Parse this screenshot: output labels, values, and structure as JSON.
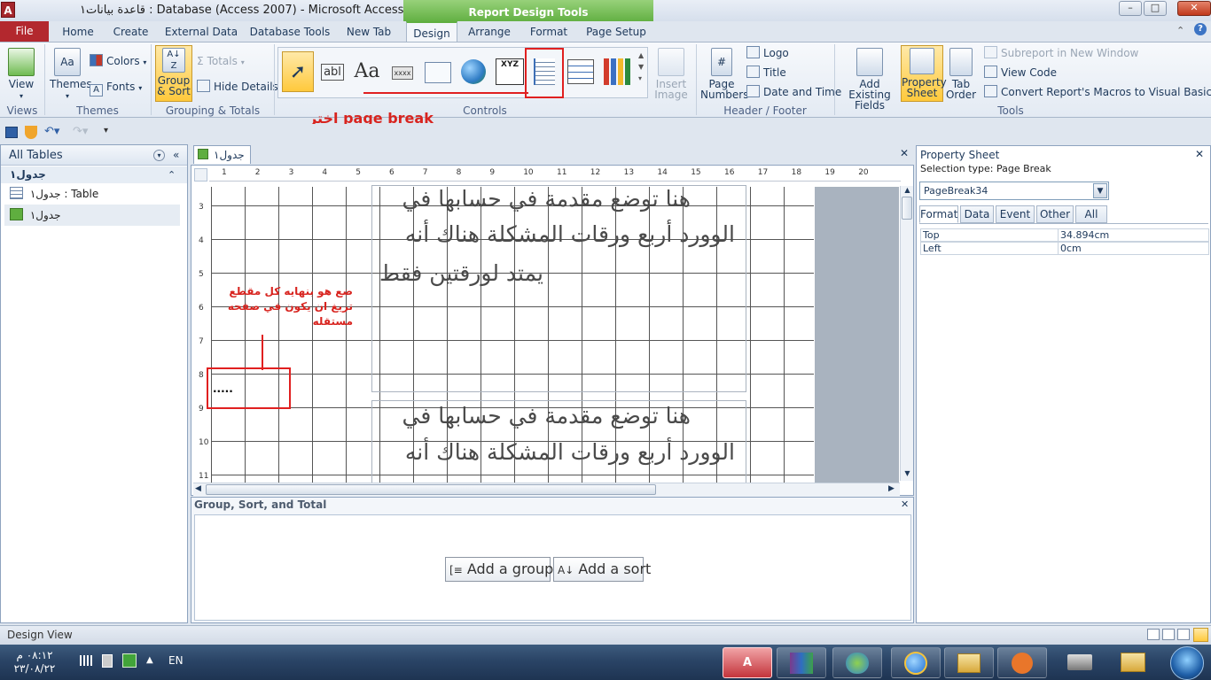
{
  "window": {
    "title": "قاعدة بيانات١ : Database (Access 2007)  -  Microsoft Access",
    "context_tab_group": "Report Design Tools",
    "app_icon_label": "A",
    "minimize": "–",
    "maximize": "□",
    "close": "✕"
  },
  "ribbon_tabs": [
    "File",
    "Home",
    "Create",
    "External Data",
    "Database Tools",
    "New Tab",
    "Design",
    "Arrange",
    "Format",
    "Page Setup"
  ],
  "ribbon": {
    "views": {
      "view_label": "View",
      "group": "Views"
    },
    "themes": {
      "themes_label": "Themes",
      "colors_label": "Colors",
      "fonts_label": "Fonts",
      "group": "Themes"
    },
    "grouping": {
      "group_sort_line1": "Group",
      "group_sort_line2": "& Sort",
      "totals_label": "Totals",
      "hide_details_label": "Hide Details",
      "group": "Grouping & Totals"
    },
    "controls": {
      "group": "Controls",
      "textbox_glyph": "abl",
      "label_glyph": "Aa",
      "button_glyph": "xxxx",
      "image_glyph": "XYZ",
      "insert_image_line1": "Insert",
      "insert_image_line2": "Image"
    },
    "header_footer": {
      "page_numbers_line1": "Page",
      "page_numbers_line2": "Numbers",
      "logo_label": "Logo",
      "title_label": "Title",
      "date_time_label": "Date and Time",
      "group": "Header / Footer"
    },
    "tools": {
      "add_fields_line1": "Add Existing",
      "add_fields_line2": "Fields",
      "property_sheet_line1": "Property",
      "property_sheet_line2": "Sheet",
      "tab_order_line1": "Tab",
      "tab_order_line2": "Order",
      "subreport_label": "Subreport in New Window",
      "view_code_label": "View Code",
      "convert_macros_label": "Convert Report's Macros to Visual Basic",
      "group": "Tools"
    }
  },
  "annotations": {
    "page_break_hint": "اختر page break",
    "arabic_note": "ضع هو بنهايه كل مقطع تريغ ان يكون في صفحه مستقله",
    "page_break_marker": "....."
  },
  "nav_pane": {
    "header": "All Tables",
    "group_name": "جدول١",
    "items": [
      {
        "label": "جدول١ : Table",
        "icon": "table-icon"
      },
      {
        "label": "جدول١",
        "icon": "report-icon"
      }
    ]
  },
  "document": {
    "tab_label": "جدول١",
    "ruler_h": [
      "1",
      "2",
      "3",
      "4",
      "5",
      "6",
      "7",
      "8",
      "9",
      "10",
      "11",
      "12",
      "13",
      "14",
      "15",
      "16",
      "17",
      "18",
      "19",
      "20"
    ],
    "ruler_v": [
      "3",
      "4",
      "5",
      "6",
      "7",
      "8",
      "9",
      "10",
      "11"
    ],
    "label1_lines": [
      "هنا توضع مقدمة في حسابها في",
      "الوورد أربع ورقات المشكلة هناك أنه",
      "يمتد لورقتين فقط"
    ],
    "label2_lines": [
      "هنا توضع مقدمة في حسابها في",
      "الوورد أربع ورقات المشكلة هناك أنه"
    ]
  },
  "gst": {
    "title": "Group, Sort, and Total",
    "add_group": "Add a group",
    "add_sort": "Add a sort"
  },
  "property_sheet": {
    "title": "Property Sheet",
    "selection_type": "Selection type:  Page Break",
    "selected_control": "PageBreak34",
    "tabs": [
      "Format",
      "Data",
      "Event",
      "Other",
      "All"
    ],
    "rows": [
      {
        "name": "Top",
        "value": "34.894cm"
      },
      {
        "name": "Left",
        "value": "0cm"
      }
    ]
  },
  "status": {
    "text": "Design View"
  },
  "taskbar": {
    "clock_time": "٠٨:١٢ م",
    "clock_date": "٢٣/٠٨/٢٢",
    "lang": "EN"
  }
}
